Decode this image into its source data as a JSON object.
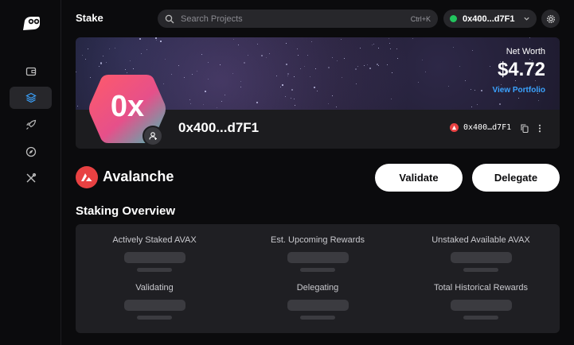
{
  "header": {
    "title": "Stake",
    "search_placeholder": "Search Projects",
    "search_shortcut": "Ctrl+K",
    "wallet_address": "0x400...d7F1",
    "wallet_status_color": "#22c55e"
  },
  "sidebar": {
    "items": [
      {
        "icon": "wallet-icon",
        "active": false
      },
      {
        "icon": "layers-icon",
        "active": true
      },
      {
        "icon": "rocket-icon",
        "active": false
      },
      {
        "icon": "compass-icon",
        "active": false
      },
      {
        "icon": "tools-icon",
        "active": false
      }
    ]
  },
  "profile": {
    "net_worth_label": "Net Worth",
    "net_worth_value": "$4.72",
    "view_portfolio_label": "View Portfolio",
    "avatar_text": "0x",
    "address": "0x400...d7F1",
    "chain_address": "0x400…d7F1"
  },
  "network": {
    "name": "Avalanche",
    "brand_color": "#e84142",
    "validate_label": "Validate",
    "delegate_label": "Delegate"
  },
  "overview": {
    "title": "Staking Overview",
    "stats": [
      {
        "label": "Actively Staked AVAX"
      },
      {
        "label": "Est. Upcoming Rewards"
      },
      {
        "label": "Unstaked Available AVAX"
      },
      {
        "label": "Validating"
      },
      {
        "label": "Delegating"
      },
      {
        "label": "Total Historical Rewards"
      }
    ]
  },
  "colors": {
    "background": "#0b0b0d",
    "panel": "#1f1f23",
    "link": "#3ba3ff"
  }
}
